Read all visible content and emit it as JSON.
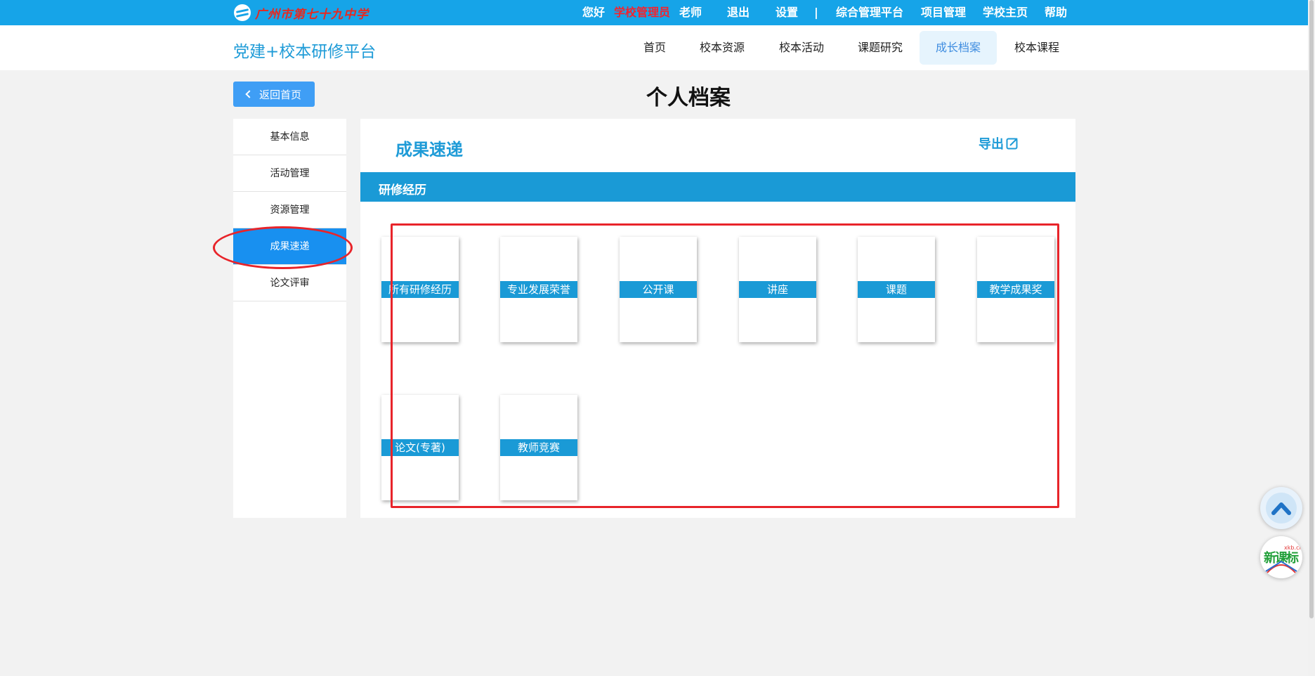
{
  "topbar": {
    "school_name": "广州市第七十九中学",
    "greeting": "您好",
    "role": "学校管理员",
    "user_suffix": "老师",
    "logout": "退出",
    "settings": "设置",
    "separator": "|",
    "links": [
      "综合管理平台",
      "项目管理",
      "学校主页",
      "帮助"
    ]
  },
  "navbar": {
    "site_title": "党建+校本研修平台",
    "items": [
      "首页",
      "校本资源",
      "校本活动",
      "课题研究",
      "成长档案",
      "校本课程"
    ],
    "active_item": "成长档案"
  },
  "page": {
    "back_label": "返回首页",
    "heading": "个人档案"
  },
  "sidebar": {
    "items": [
      "基本信息",
      "活动管理",
      "资源管理",
      "成果速递",
      "论文评审"
    ],
    "active_item": "成果速递"
  },
  "panel": {
    "title": "成果速递",
    "export_label": "导出",
    "section_label": "研修经历",
    "cards": [
      "所有研修经历",
      "专业发展荣誉",
      "公开课",
      "讲座",
      "课题",
      "教学成果奖",
      "论文(专著)",
      "教师竞赛"
    ]
  },
  "floating": {
    "xkb_logo": "新课标",
    "xkb_domain": "xkb.cn"
  },
  "colors": {
    "topbar_bg": "#16a4e8",
    "accent": "#1a9ad6",
    "active_side": "#1890f0",
    "annotation": "#e8242a"
  }
}
